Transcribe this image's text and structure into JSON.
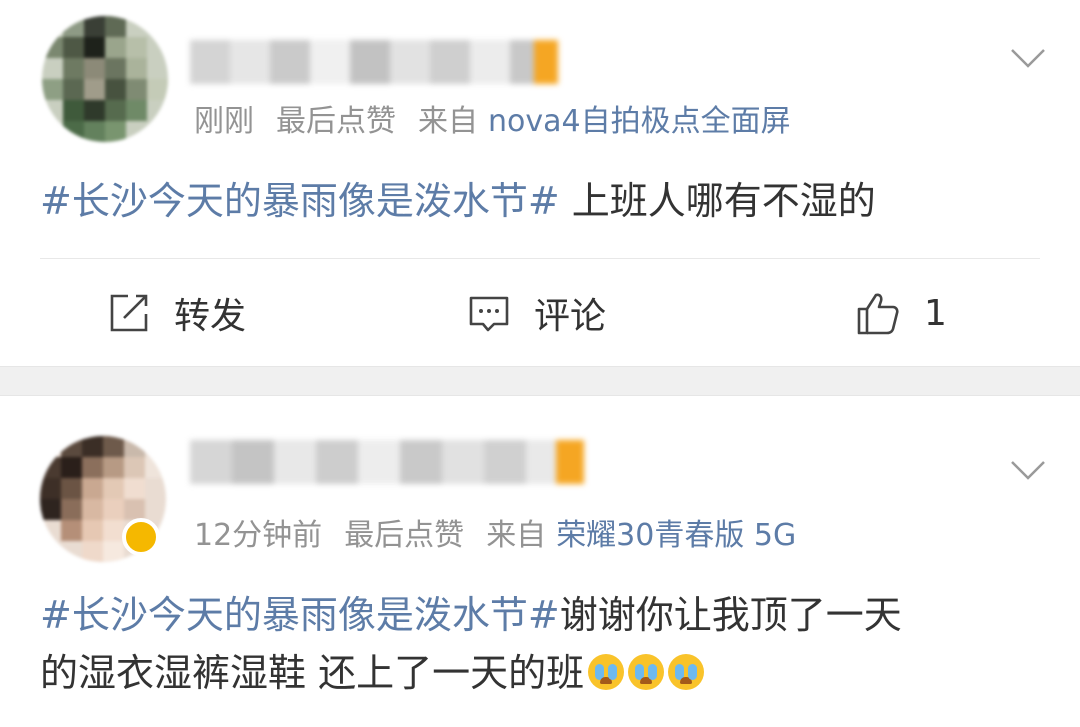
{
  "colors": {
    "topic": "#5d7ca7",
    "meta": "#939393",
    "text": "#333333",
    "separator": "#f0f0f0"
  },
  "posts": [
    {
      "time": "刚刚",
      "action_note": "最后点赞",
      "source_prefix": "来自",
      "source": "nova4自拍极点全面屏",
      "topic": "#长沙今天的暴雨像是泼水节#",
      "text_line1": " 上班人哪有不湿的",
      "text_line2": "",
      "emojis": [],
      "actions": {
        "repost": "转发",
        "comment": "评论",
        "like": "1"
      },
      "icons": {
        "menu": "chevron-down-icon",
        "repost": "repost-icon",
        "comment": "comment-icon",
        "like": "thumbs-up-icon"
      }
    },
    {
      "time": "12分钟前",
      "action_note": "最后点赞",
      "source_prefix": "来自",
      "source": "荣耀30青春版 5G",
      "topic": "#长沙今天的暴雨像是泼水节#",
      "text_line1": "谢谢你让我顶了一天",
      "text_line2": "的湿衣湿裤湿鞋 还上了一天的班",
      "emojis": [
        "crying-emoji",
        "crying-emoji",
        "crying-emoji"
      ],
      "icons": {
        "menu": "chevron-down-icon"
      }
    }
  ]
}
